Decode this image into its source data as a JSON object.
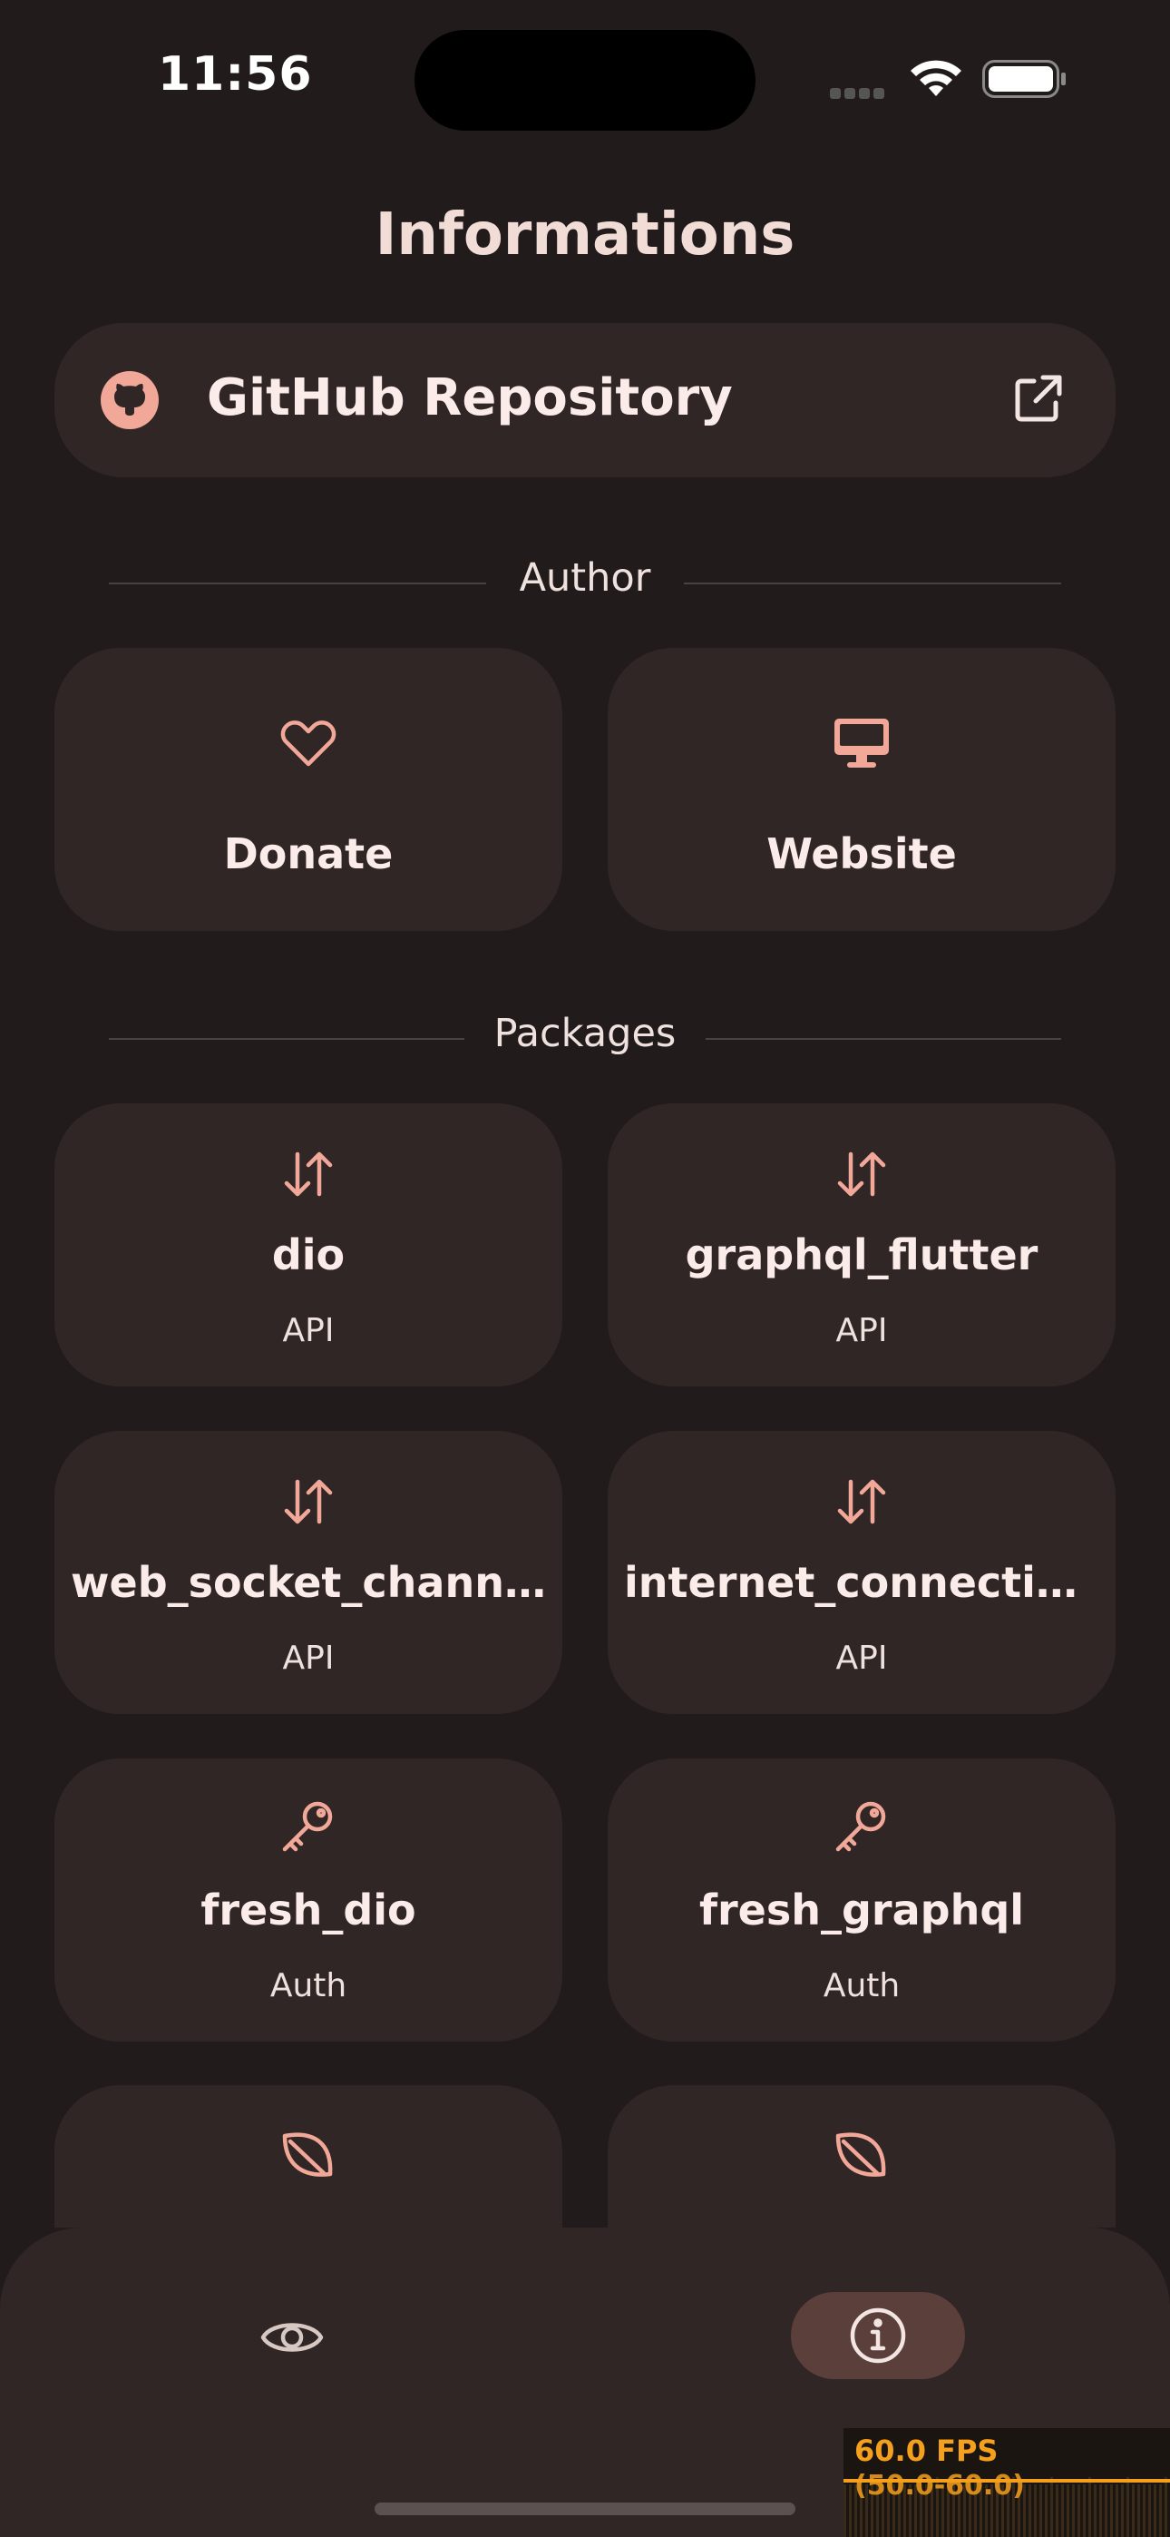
{
  "status_bar": {
    "time": "11:56"
  },
  "page": {
    "title": "Informations"
  },
  "github": {
    "label": "GitHub Repository"
  },
  "sections": {
    "author": "Author",
    "packages": "Packages"
  },
  "author_cards": [
    {
      "title": "Donate",
      "icon": "heart-icon"
    },
    {
      "title": "Website",
      "icon": "monitor-icon"
    }
  ],
  "packages": [
    {
      "title": "dio",
      "category": "API",
      "icon": "swap-arrows-icon"
    },
    {
      "title": "graphql_flutter",
      "category": "API",
      "icon": "swap-arrows-icon"
    },
    {
      "title": "web_socket_channel",
      "category": "API",
      "icon": "swap-arrows-icon"
    },
    {
      "title": "internet_connectio...",
      "category": "API",
      "icon": "swap-arrows-icon"
    },
    {
      "title": "fresh_dio",
      "category": "Auth",
      "icon": "key-icon"
    },
    {
      "title": "fresh_graphql",
      "category": "Auth",
      "icon": "key-icon"
    },
    {
      "title": "",
      "category": "",
      "icon": "leaf-icon"
    },
    {
      "title": "",
      "category": "",
      "icon": "leaf-icon"
    }
  ],
  "nav": {
    "selected": "info"
  },
  "fps_overlay": {
    "fps": "60.0 FPS",
    "range": "(50.0-60.0)"
  },
  "colors": {
    "background": "#211c1b",
    "card": "#302625",
    "accent": "#f2a899",
    "nav_pill": "#5a3f3b",
    "fps": "#f5a01c"
  }
}
